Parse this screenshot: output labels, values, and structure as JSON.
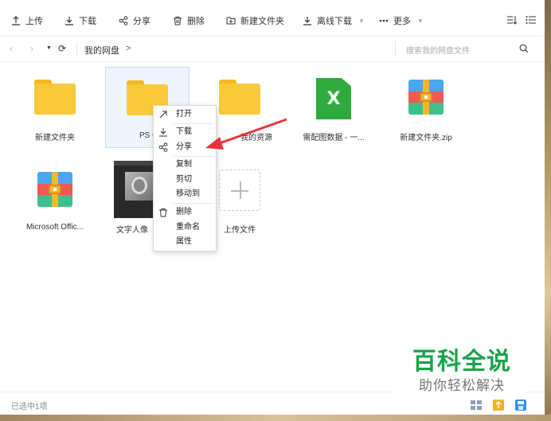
{
  "toolbar": {
    "upload": "上传",
    "download": "下载",
    "share": "分享",
    "delete": "删除",
    "new_folder": "新建文件夹",
    "offline_download": "离线下载",
    "more": "更多"
  },
  "address": {
    "breadcrumb": "我的网盘",
    "breadcrumb_arrow": ">",
    "search_placeholder": "搜索我的网盘文件"
  },
  "files": [
    {
      "name": "新建文件夹",
      "type": "folder"
    },
    {
      "name": "PS C",
      "type": "folder",
      "selected": true
    },
    {
      "name": "我的资源",
      "type": "folder"
    },
    {
      "name": "需配图数据 - 一...",
      "type": "excel",
      "icon_letter": "X"
    },
    {
      "name": "新建文件夹.zip",
      "type": "zip"
    },
    {
      "name": "Microsoft Offic...",
      "type": "zip"
    },
    {
      "name": "文字人像",
      "type": "image"
    },
    {
      "name": "上传文件",
      "type": "upload"
    }
  ],
  "context_menu": {
    "open": "打开",
    "download": "下载",
    "share": "分享",
    "copy": "复制",
    "cut": "剪切",
    "move_to": "移动到",
    "delete": "删除",
    "rename": "重命名",
    "properties": "属性"
  },
  "status": {
    "selection": "已选中1项"
  },
  "watermark": {
    "title": "百科全说",
    "subtitle": "助你轻松解决"
  },
  "colors": {
    "folder": "#f9c93c",
    "excel": "#2faa3e",
    "selection_bg": "#eef5ff",
    "arrow": "#e8333c",
    "watermark_green": "#1aa34a"
  }
}
